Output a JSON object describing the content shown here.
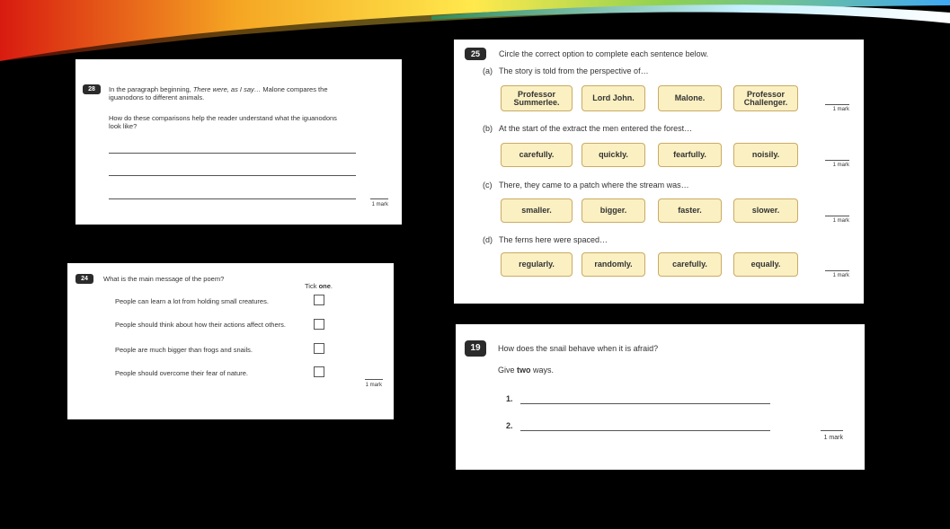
{
  "q28": {
    "number": "28",
    "line1_prefix": "In the paragraph beginning, ",
    "line1_italic": "There were, as I say…",
    "line1_suffix": " Malone compares the",
    "line2": "iguanodons to different animals.",
    "question_line1": "How do these comparisons help the reader understand what the iguanodons",
    "question_line2": "look like?",
    "mark": "1 mark"
  },
  "q24": {
    "number": "24",
    "question": "What is the main message of the poem?",
    "tick_prefix": "Tick ",
    "tick_bold": "one",
    "tick_suffix": ".",
    "options": [
      "People can learn a lot from holding small creatures.",
      "People should think about how their actions affect others.",
      "People are much bigger than frogs and snails.",
      "People should overcome their fear of nature."
    ],
    "mark": "1 mark"
  },
  "q25": {
    "number": "25",
    "instruction": "Circle the correct option to complete each sentence below.",
    "parts": [
      {
        "label": "(a)",
        "text": "The story is told from the perspective of…",
        "options": [
          "Professor Summerlee.",
          "Lord John.",
          "Malone.",
          "Professor Challenger."
        ],
        "mark": "1 mark"
      },
      {
        "label": "(b)",
        "text": "At the start of the extract the men entered the forest…",
        "options": [
          "carefully.",
          "quickly.",
          "fearfully.",
          "noisily."
        ],
        "mark": "1 mark"
      },
      {
        "label": "(c)",
        "text": "There, they came to a patch where the stream was…",
        "options": [
          "smaller.",
          "bigger.",
          "faster.",
          "slower."
        ],
        "mark": "1 mark"
      },
      {
        "label": "(d)",
        "text": "The ferns here were spaced…",
        "options": [
          "regularly.",
          "randomly.",
          "carefully.",
          "equally."
        ],
        "mark": "1 mark"
      }
    ]
  },
  "q19": {
    "number": "19",
    "question": "How does the snail behave when it is afraid?",
    "give_prefix": "Give ",
    "give_bold": "two",
    "give_suffix": " ways.",
    "answer1": "1.",
    "answer2": "2.",
    "mark": "1 mark"
  }
}
